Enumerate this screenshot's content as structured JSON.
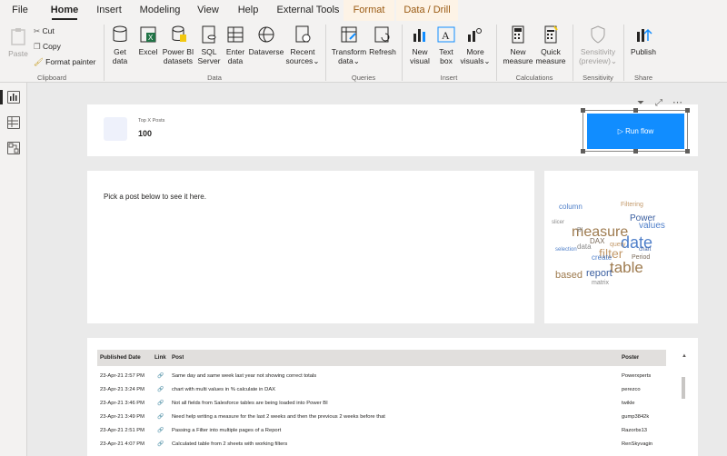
{
  "tabs": [
    "File",
    "Home",
    "Insert",
    "Modeling",
    "View",
    "Help",
    "External Tools",
    "Format",
    "Data / Drill"
  ],
  "ribbon": {
    "clipboard": {
      "paste": "Paste",
      "cut": "Cut",
      "copy": "Copy",
      "format_painter": "Format painter",
      "group": "Clipboard"
    },
    "data": {
      "get_data": [
        "Get",
        "data"
      ],
      "excel": "Excel",
      "powerbi": [
        "Power BI",
        "datasets"
      ],
      "sql": [
        "SQL",
        "Server"
      ],
      "enter": [
        "Enter",
        "data"
      ],
      "dataverse": "Dataverse",
      "recent": [
        "Recent",
        "sources"
      ],
      "group": "Data"
    },
    "queries": {
      "transform": [
        "Transform",
        "data"
      ],
      "refresh": "Refresh",
      "group": "Queries"
    },
    "insert": {
      "new_visual": [
        "New",
        "visual"
      ],
      "text_box": [
        "Text",
        "box"
      ],
      "more_visuals": [
        "More",
        "visuals"
      ],
      "group": "Insert"
    },
    "calculations": {
      "new_measure": [
        "New",
        "measure"
      ],
      "quick_measure": [
        "Quick",
        "measure"
      ],
      "group": "Calculations"
    },
    "sensitivity": {
      "label": [
        "Sensitivity",
        "(preview)"
      ],
      "group": "Sensitivity"
    },
    "share": {
      "publish": "Publish",
      "group": "Share"
    }
  },
  "kpi": {
    "label": "Top X Posts",
    "value": "100"
  },
  "run_flow": {
    "label": "Run flow"
  },
  "post_panel": {
    "text": "Pick a post below to see it here."
  },
  "table": {
    "headers": [
      "Published Date",
      "Link",
      "Post",
      "Poster"
    ],
    "rows": [
      [
        "23-Apr-21 2:57 PM",
        "Same day and same week last year not showing correct totals",
        "Powerxperts"
      ],
      [
        "23-Apr-21 3:24 PM",
        "chart with multi values in % calculate in DAX",
        "perezco"
      ],
      [
        "23-Apr-21 3:46 PM",
        "Not all fields from Salesforce tables are being loaded into Power BI",
        "twikle"
      ],
      [
        "23-Apr-21 3:49 PM",
        "Need help writing a measure for the last 2 weeks and then the previous 2 weeks before that",
        "gump3842k"
      ],
      [
        "23-Apr-21 2:51 PM",
        "Passing a Filter into multiple pages of a Report",
        "Razorbs13"
      ],
      [
        "23-Apr-21 4:07 PM",
        "Calculated table from 2 sheets with working filters",
        "RenSkyvagin"
      ]
    ]
  },
  "wordcloud": [
    "column",
    "measure",
    "date",
    "table",
    "filter",
    "Power",
    "values",
    "based",
    "report",
    "DAX",
    "matrix",
    "query",
    "data",
    "Period",
    "create",
    "BI",
    "Filtering",
    "slicer",
    "chart",
    "selection"
  ],
  "colors": {
    "accent": "#118dff",
    "wordcloud": [
      "#4f7fc9",
      "#9e7b4f",
      "#8a8a8a",
      "#c39a6b",
      "#3b5fa0",
      "#7a6a5a"
    ]
  }
}
